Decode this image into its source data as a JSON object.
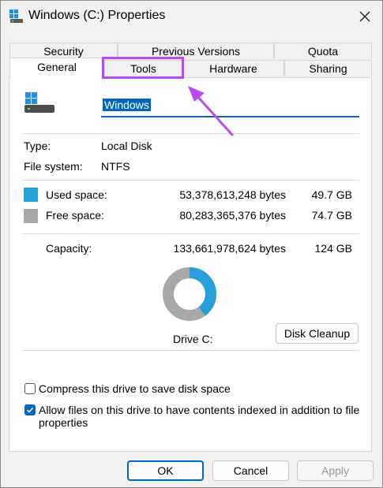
{
  "window": {
    "title": "Windows (C:) Properties"
  },
  "tabs": {
    "row_back": [
      "Security",
      "Previous Versions",
      "Quota"
    ],
    "row_front": [
      "General",
      "Tools",
      "Hardware",
      "Sharing"
    ],
    "active": "General",
    "highlighted": "Tools"
  },
  "drive": {
    "name": "Windows",
    "type_label": "Type:",
    "type_value": "Local Disk",
    "fs_label": "File system:",
    "fs_value": "NTFS"
  },
  "space": {
    "used_label": "Used space:",
    "used_bytes": "53,378,613,248 bytes",
    "used_gb": "49.7 GB",
    "free_label": "Free space:",
    "free_bytes": "80,283,365,376 bytes",
    "free_gb": "74.7 GB",
    "capacity_label": "Capacity:",
    "capacity_bytes": "133,661,978,624 bytes",
    "capacity_gb": "124 GB",
    "used_fraction": 0.4,
    "used_color": "#26a0da",
    "free_color": "#a8a8a8"
  },
  "chart_label": "Drive C:",
  "disk_cleanup_label": "Disk Cleanup",
  "options": {
    "compress_label": "Compress this drive to save disk space",
    "compress_checked": false,
    "index_label_line1": "Allow files on this drive to have contents indexed in addition to file",
    "index_label_line2": "properties",
    "index_checked": true
  },
  "buttons": {
    "ok": "OK",
    "cancel": "Cancel",
    "apply": "Apply"
  },
  "highlight_color": "#b84cf2"
}
